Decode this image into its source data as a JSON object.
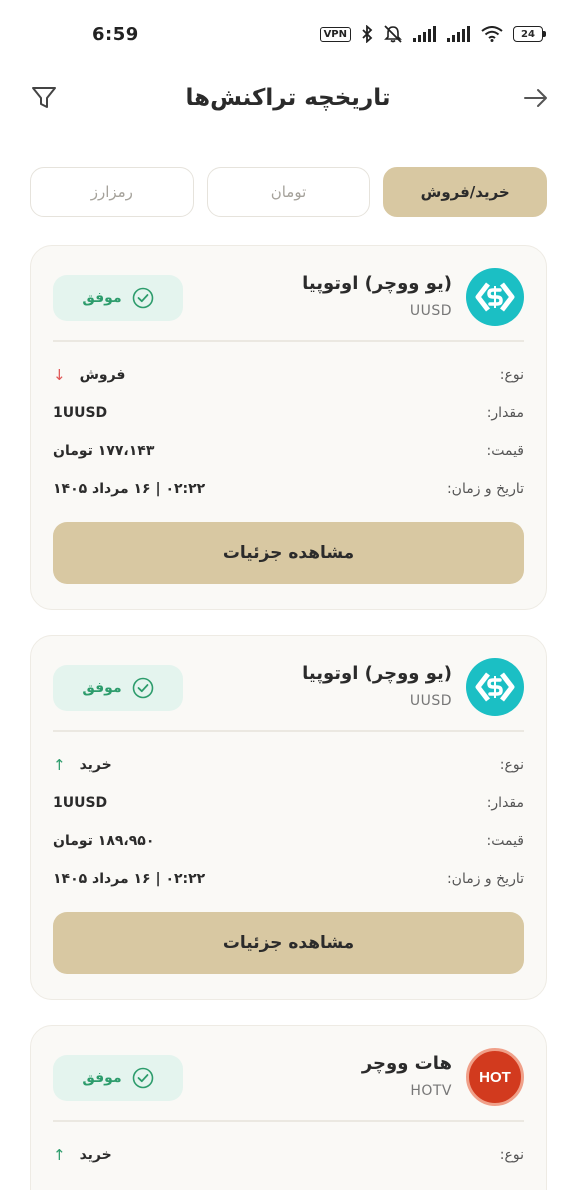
{
  "status_bar": {
    "time": "6:59",
    "vpn": "VPN",
    "battery": "24"
  },
  "header": {
    "title": "تاریخچه تراکنش‌ها"
  },
  "tabs": [
    {
      "label": "خرید/فروش",
      "active": true
    },
    {
      "label": "تومان",
      "active": false
    },
    {
      "label": "رمزارز",
      "active": false
    }
  ],
  "labels": {
    "type": "نوع:",
    "amount": "مقدار:",
    "price": "قیمت:",
    "datetime": "تاریخ و زمان:",
    "details_button": "مشاهده جزئیات"
  },
  "transactions": [
    {
      "coin_name": "(یو ووچر) اوتوپیا",
      "symbol": "UUSD",
      "status": "موفق",
      "type": "فروش",
      "direction": "down",
      "amount": "1UUSD",
      "price": "۱۷۷،۱۴۳ تومان",
      "datetime": "۰۲:۲۲ | ۱۶ مرداد ۱۴۰۵",
      "logo": "utopia-icon"
    },
    {
      "coin_name": "(یو ووچر) اوتوپیا",
      "symbol": "UUSD",
      "status": "موفق",
      "type": "خرید",
      "direction": "up",
      "amount": "1UUSD",
      "price": "۱۸۹،۹۵۰ تومان",
      "datetime": "۰۲:۲۲ | ۱۶ مرداد ۱۴۰۵",
      "logo": "utopia-icon"
    },
    {
      "coin_name": "هات ووچر",
      "symbol": "HOTV",
      "status": "موفق",
      "type": "خرید",
      "direction": "up",
      "logo": "hot-voucher-icon",
      "logo_text": "HOT"
    }
  ],
  "colors": {
    "accent": "#d8c8a2",
    "success": "#2d9c6c",
    "success_bg": "#e4f4ee",
    "sell": "#e05555",
    "utopia": "#1bbfc4",
    "hot": "#d23a1e"
  }
}
